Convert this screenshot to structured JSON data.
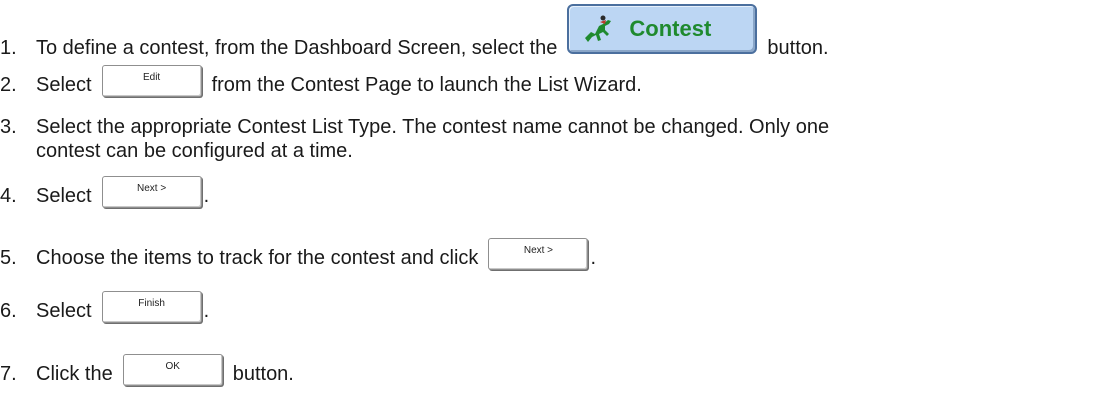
{
  "steps": [
    {
      "num": "1.",
      "before": "To define a contest, from the Dashboard Screen, select the",
      "button": "Contest",
      "after": "button."
    },
    {
      "num": "2.",
      "before": "Select",
      "button": "Edit",
      "after": "from the Contest Page to launch the List Wizard."
    },
    {
      "num": "3.",
      "line1": "Select the appropriate Contest List Type. The contest name cannot be changed. Only one",
      "line2": "contest can be configured at a time."
    },
    {
      "num": "4.",
      "before": "Select",
      "button": "Next >",
      "after": "."
    },
    {
      "num": "5.",
      "before": "Choose the items to track for the contest and click",
      "button": "Next >",
      "after": "."
    },
    {
      "num": "6.",
      "before": "Select",
      "button": "Finish",
      "after": "."
    },
    {
      "num": "7.",
      "before": "Click the",
      "button": "OK",
      "after": "button."
    }
  ],
  "icons": {
    "contest_button_icon": "running-horse-icon"
  },
  "colors": {
    "contest_button_bg": "#bcd6f3",
    "contest_label": "#1f8a2e"
  }
}
